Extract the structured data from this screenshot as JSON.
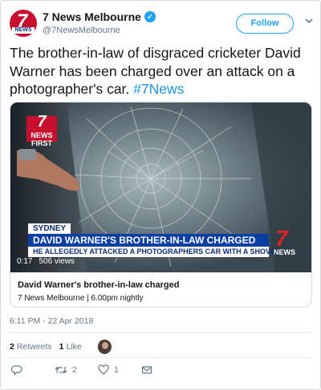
{
  "account": {
    "name": "7 News Melbourne",
    "handle": "@7NewsMelbourne",
    "avatar_text": "7",
    "avatar_badge": "NEWS"
  },
  "follow_label": "Follow",
  "tweet": {
    "text": "The brother-in-law of disgraced cricketer David Warner has been charged over an attack on a photographer's car.",
    "hashtag": "#7News"
  },
  "video": {
    "logo_top": "7",
    "logo_bottom": "NEWS FIRST",
    "location": "SYDNEY",
    "headline": "DAVID WARNER'S BROTHER-IN-LAW CHARGED",
    "subheadline": "HE ALLEGEDLY ATTACKED A PHOTOGRAPHERS CAR WITH A SHOVEL",
    "brand_num": "7",
    "brand_text": "NEWS",
    "duration": "0:17",
    "views": "506 views"
  },
  "card": {
    "title": "David Warner's brother-in-law charged",
    "subtitle": "7 News Melbourne | 6.00pm nightly"
  },
  "timestamp": "6:11 PM - 22 Apr 2018",
  "stats": {
    "retweets_count": "2",
    "retweets_label": "Retweets",
    "likes_count": "1",
    "likes_label": "Like"
  },
  "actions": {
    "retweet_count": "2",
    "like_count": "1"
  },
  "colors": {
    "accent": "#1da1f2",
    "hashtag": "#1b95e0",
    "brand_red": "#c8102e",
    "lower_third_blue": "#0c3fa4"
  }
}
